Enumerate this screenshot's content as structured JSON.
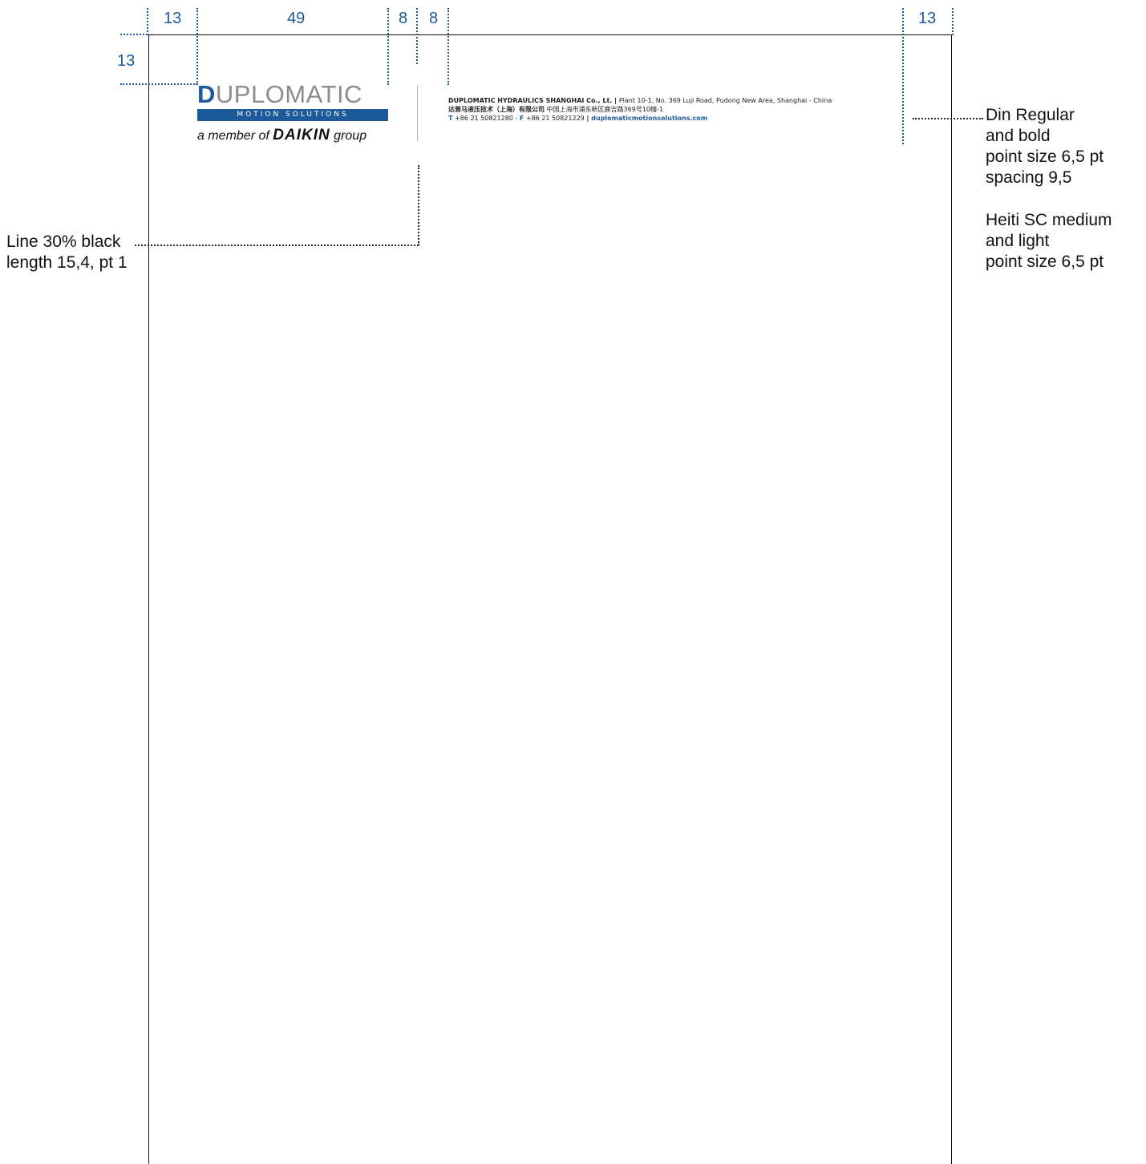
{
  "dimensions": {
    "left_margin": "13",
    "logo_width": "49",
    "gap_before_rule": "8",
    "gap_after_rule": "8",
    "right_margin": "13",
    "top_margin": "13"
  },
  "logo": {
    "wordmark": "DUPLOMATIC",
    "subline": "MOTION SOLUTIONS",
    "member_prefix": "a member of",
    "member_brand": "DAIKIN",
    "member_suffix": "group",
    "brand_color": "#1d5a9c",
    "grey_color": "#8a8c8e"
  },
  "address": {
    "company": "DUPLOMATIC HYDRAULICS SHANGHAI Co., Lt.",
    "sep1": " | ",
    "street": "Plant 10-1, No. 369 Luji Road, Pudong New Area, Shanghai - China",
    "company_cn": "达普马液压技术（上海）有限公司",
    "street_cn": "中国上海市浦东新区鹿吉路369号10幢-1",
    "t_label": "T",
    "t_number": "+86 21 50821280",
    "dash": " - ",
    "f_label": "F",
    "f_number": "+86 21 50821229",
    "sep2": " | ",
    "website": "duplomaticmotionsolutions.com"
  },
  "notes": {
    "line_spec_1": "Line 30% black",
    "line_spec_2": "length 15,4, pt 1",
    "font_spec_1": "Din Regular",
    "font_spec_2": "and bold",
    "font_spec_3": "point size 6,5 pt",
    "font_spec_4": "spacing 9,5",
    "font_spec_5": "Heiti SC medium",
    "font_spec_6": "and light",
    "font_spec_7": "point size 6,5 pt"
  }
}
